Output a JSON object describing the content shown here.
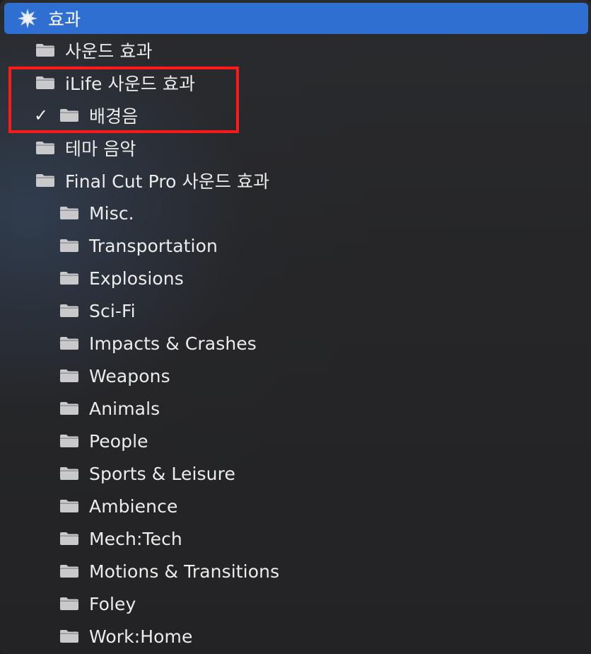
{
  "header": {
    "label": "효과",
    "icon": "starburst-icon"
  },
  "items": [
    {
      "label": "사운드 효과",
      "checked": false
    },
    {
      "label": "iLife 사운드 효과",
      "checked": false
    },
    {
      "label": "배경음",
      "checked": true,
      "check_mark": "✓"
    },
    {
      "label": "테마 음악",
      "checked": false
    },
    {
      "label": "Final Cut Pro 사운드 효과",
      "checked": false
    }
  ],
  "subitems": [
    {
      "label": "Misc."
    },
    {
      "label": "Transportation"
    },
    {
      "label": "Explosions"
    },
    {
      "label": "Sci-Fi"
    },
    {
      "label": "Impacts & Crashes"
    },
    {
      "label": "Weapons"
    },
    {
      "label": "Animals"
    },
    {
      "label": "People"
    },
    {
      "label": "Sports & Leisure"
    },
    {
      "label": "Ambience"
    },
    {
      "label": "Mech:Tech"
    },
    {
      "label": "Motions & Transitions"
    },
    {
      "label": "Foley"
    },
    {
      "label": "Work:Home"
    }
  ],
  "colors": {
    "selection": "#2f6fd1",
    "highlight_box": "#ff1a1a",
    "folder": "#c9c9cc"
  }
}
